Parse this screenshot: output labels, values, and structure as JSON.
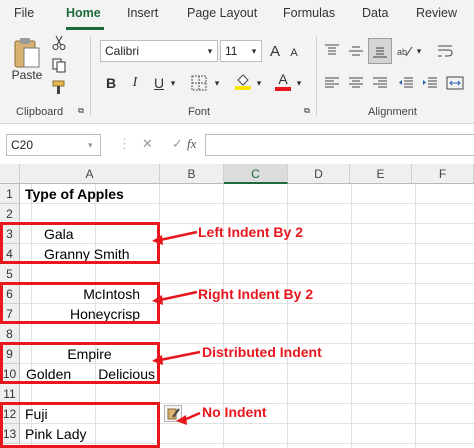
{
  "menu": {
    "tabs": [
      "File",
      "Home",
      "Insert",
      "Page Layout",
      "Formulas",
      "Data",
      "Review"
    ],
    "active_tab": "Home"
  },
  "ribbon": {
    "clipboard": {
      "paste_label": "Paste",
      "group_label": "Clipboard"
    },
    "font": {
      "font_name": "Calibri",
      "font_size": "11",
      "bold": "B",
      "italic": "I",
      "underline": "U",
      "increase": "A",
      "decrease": "A",
      "font_color": "A",
      "group_label": "Font"
    },
    "alignment": {
      "group_label": "Alignment"
    },
    "accent_color": "#1d6b3a",
    "highlight_color": "#ffe600",
    "font_color_bar": "#e8171e"
  },
  "formula_bar": {
    "name_box": "C20",
    "cancel": "✕",
    "enter": "✓",
    "fx": "fx",
    "value": ""
  },
  "sheet": {
    "columns": [
      "A",
      "B",
      "C",
      "D",
      "E",
      "F"
    ],
    "rows": [
      {
        "num": "1",
        "a": "Type of Apples"
      },
      {
        "num": "2",
        "a": ""
      },
      {
        "num": "3",
        "a": "Gala"
      },
      {
        "num": "4",
        "a": "Granny Smith"
      },
      {
        "num": "5",
        "a": ""
      },
      {
        "num": "6",
        "a": "McIntosh"
      },
      {
        "num": "7",
        "a": "Honeycrisp"
      },
      {
        "num": "8",
        "a": ""
      },
      {
        "num": "9",
        "a": "Empire"
      },
      {
        "num": "10",
        "a_left": "Golden",
        "a_right": "Delicious"
      },
      {
        "num": "11",
        "a": ""
      },
      {
        "num": "12",
        "a": "Fuji"
      },
      {
        "num": "13",
        "a": "Pink Lady"
      }
    ]
  },
  "annotations": {
    "left": "Left Indent By 2",
    "right": "Right Indent By 2",
    "distributed": "Distributed Indent",
    "none": "No Indent",
    "color": "#e8171e"
  }
}
